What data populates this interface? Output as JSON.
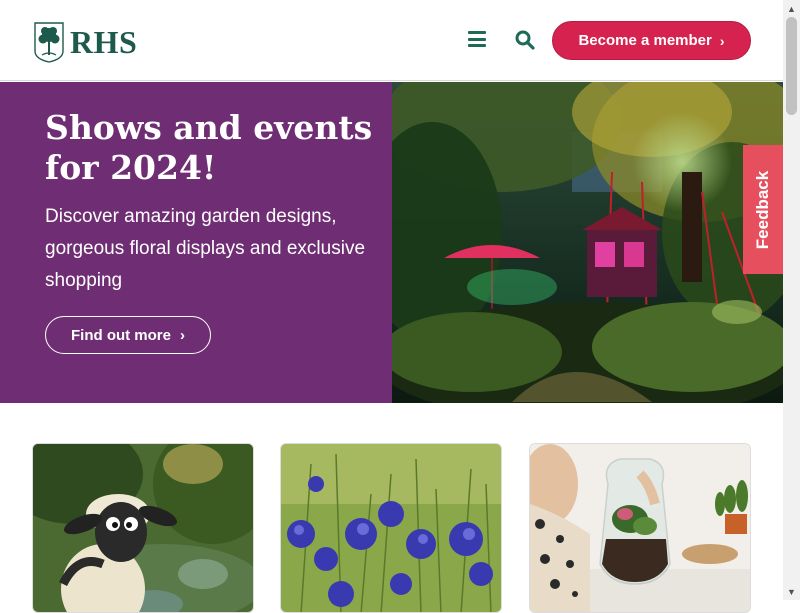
{
  "header": {
    "logo_text": "RHS",
    "menu_icon": "hamburger-icon",
    "search_icon": "search-icon",
    "member_button": "Become a member",
    "member_chevron": "›"
  },
  "hero": {
    "title": "Shows and events for 2024!",
    "description": "Discover amazing garden designs, gorgeous floral displays and exclusive shopping",
    "cta_label": "Find out more",
    "cta_chevron": "›",
    "background_color": "#6f2e73",
    "image_icon": "illuminated-garden-image"
  },
  "feedback": {
    "label": "Feedback"
  },
  "cards": [
    {
      "image_icon": "sheep-in-garden-image"
    },
    {
      "image_icon": "agapanthus-flowers-image"
    },
    {
      "image_icon": "child-terrarium-image"
    }
  ],
  "colors": {
    "brand_green": "#1e5a4c",
    "member_pink": "#d5224f",
    "feedback_red": "#e6505e",
    "hero_purple": "#6f2e73"
  }
}
